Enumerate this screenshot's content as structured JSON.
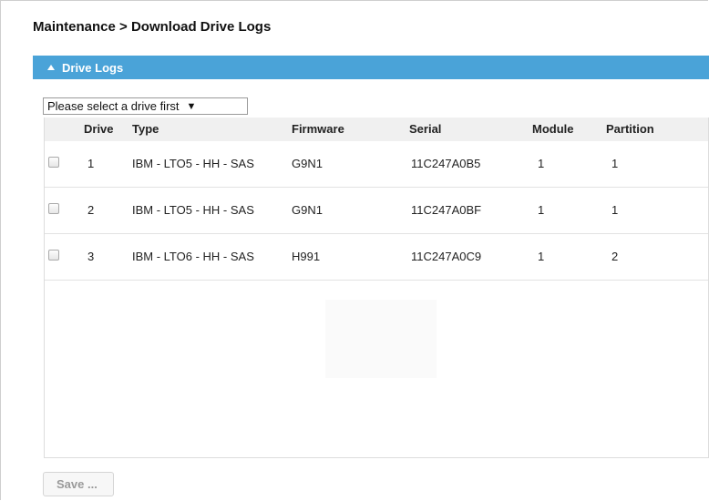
{
  "header": {
    "breadcrumb": "Maintenance > Download Drive Logs"
  },
  "panel": {
    "title": "Drive Logs",
    "collapse_icon": "triangle-up-icon"
  },
  "drive_select": {
    "value": "Please select a drive first",
    "arrow": "▼"
  },
  "table": {
    "columns": [
      "Drive",
      "Type",
      "Firmware",
      "Serial",
      "Module",
      "Partition"
    ],
    "rows": [
      {
        "drive": "1",
        "type": "IBM - LTO5 - HH - SAS",
        "firmware": "G9N1",
        "serial": "11C247A0B5",
        "module": "1",
        "partition": "1"
      },
      {
        "drive": "2",
        "type": "IBM - LTO5 - HH - SAS",
        "firmware": "G9N1",
        "serial": "11C247A0BF",
        "module": "1",
        "partition": "1"
      },
      {
        "drive": "3",
        "type": "IBM - LTO6 - HH - SAS",
        "firmware": "H991",
        "serial": "11C247A0C9",
        "module": "1",
        "partition": "2"
      }
    ]
  },
  "actions": {
    "save_label": "Save ..."
  },
  "colors": {
    "panel_header": "#4aa3d8"
  }
}
